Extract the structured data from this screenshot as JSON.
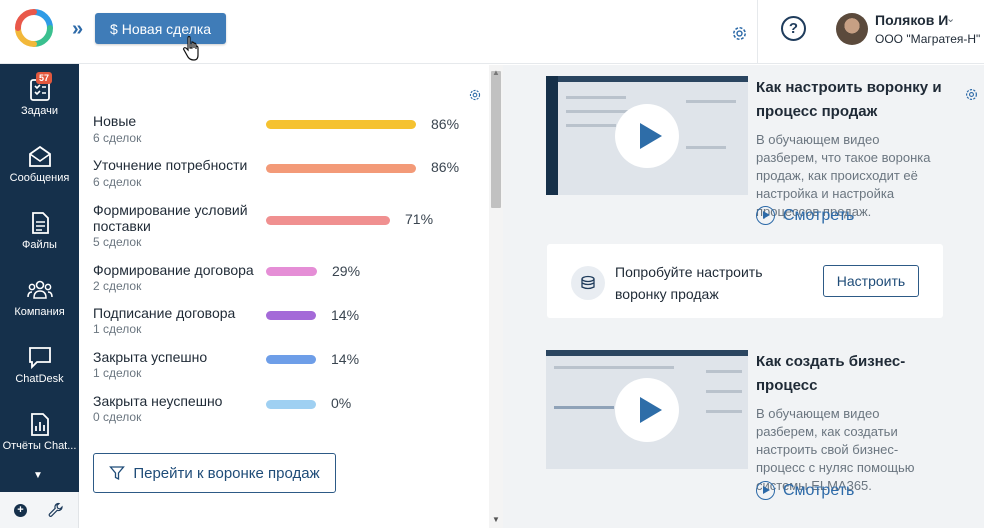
{
  "header": {
    "new_deal_label": "Новая сделка",
    "new_deal_icon": "$",
    "user_name": "Поляков И",
    "user_org": "ООО \"Магратея-Н\"",
    "help_label": "?"
  },
  "sidebar": {
    "items": [
      {
        "label": "Задачи",
        "icon": "tasks-icon",
        "badge": "57"
      },
      {
        "label": "Сообщения",
        "icon": "messages-icon"
      },
      {
        "label": "Файлы",
        "icon": "files-icon"
      },
      {
        "label": "Компания",
        "icon": "company-icon"
      },
      {
        "label": "ChatDesk",
        "icon": "chatdesk-icon"
      },
      {
        "label": "Отчёты Chat...",
        "icon": "reports-icon"
      }
    ]
  },
  "funnel": {
    "stages": [
      {
        "name": "Новые",
        "count": "6 сделок",
        "percent": "86%",
        "value": 86,
        "color": "#f5c230"
      },
      {
        "name": "Уточнение потребности",
        "count": "6 сделок",
        "percent": "86%",
        "value": 86,
        "color": "#f39a78"
      },
      {
        "name": "Формирование условий поставки",
        "count": "5 сделок",
        "percent": "71%",
        "value": 71,
        "color": "#f09090"
      },
      {
        "name": "Формирование договора",
        "count": "2 сделок",
        "percent": "29%",
        "value": 29,
        "color": "#e58ed6"
      },
      {
        "name": "Подписание договора",
        "count": "1 сделок",
        "percent": "14%",
        "value": 14,
        "color": "#a46ad8"
      },
      {
        "name": "Закрыта успешно",
        "count": "1 сделок",
        "percent": "14%",
        "value": 14,
        "color": "#6e9ee8"
      },
      {
        "name": "Закрыта неуспешно",
        "count": "0 сделок",
        "percent": "0%",
        "value": 0,
        "color": "#9fd0f2"
      }
    ],
    "button_label": "Перейти к воронке продаж"
  },
  "videos": [
    {
      "title": "Как настроить воронку и процесс продаж",
      "description": "В обучающем видео разберем, что такое воронка продаж, как происходит её настройка и настройка процессов продаж.",
      "watch_label": "Смотреть"
    },
    {
      "title": "Как создать бизнес-процесс",
      "description": "В обучающем видео разберем, как создатьи настроить свой бизнес-процесс с нуляс помощью системы ELMA365.",
      "watch_label": "Смотреть"
    }
  ],
  "try_card": {
    "text": "Попробуйте настроить воронку продаж",
    "button_label": "Настроить"
  }
}
